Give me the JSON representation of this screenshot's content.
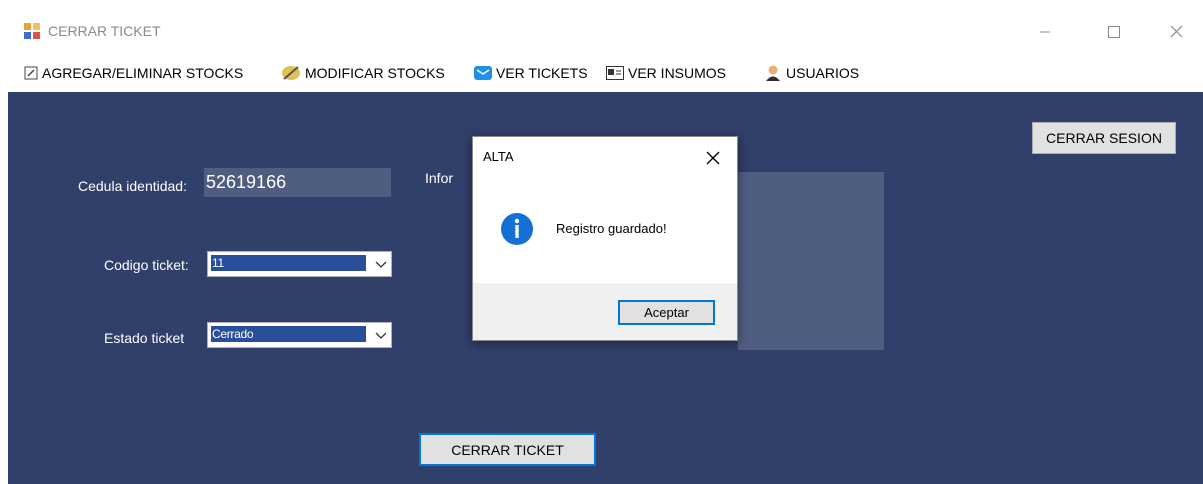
{
  "window": {
    "title": "CERRAR TICKET"
  },
  "menu": {
    "items": [
      {
        "label": "AGREGAR/ELIMINAR STOCKS",
        "icon": "notepad-icon"
      },
      {
        "label": "MODIFICAR STOCKS",
        "icon": "pencil-icon"
      },
      {
        "label": "VER TICKETS",
        "icon": "mail-icon"
      },
      {
        "label": "VER INSUMOS",
        "icon": "card-icon"
      },
      {
        "label": "USUARIOS",
        "icon": "user-icon"
      }
    ]
  },
  "form": {
    "cedula_label": "Cedula identidad:",
    "cedula_value": "52619166",
    "codigo_label": "Codigo ticket:",
    "codigo_value": "11",
    "estado_label": "Estado ticket",
    "estado_value": "Cerrado",
    "info_label_partial": "Infor",
    "close_ticket_button": "CERRAR TICKET",
    "logout_button": "CERRAR SESION"
  },
  "dialog": {
    "title": "ALTA",
    "message": "Registro guardado!",
    "ok_button": "Aceptar",
    "icon": "info-icon"
  },
  "colors": {
    "client_background": "#313f6b",
    "field_background": "#4f5d80",
    "selection": "#2a4f9a",
    "dialog_accent": "#0078d7"
  }
}
